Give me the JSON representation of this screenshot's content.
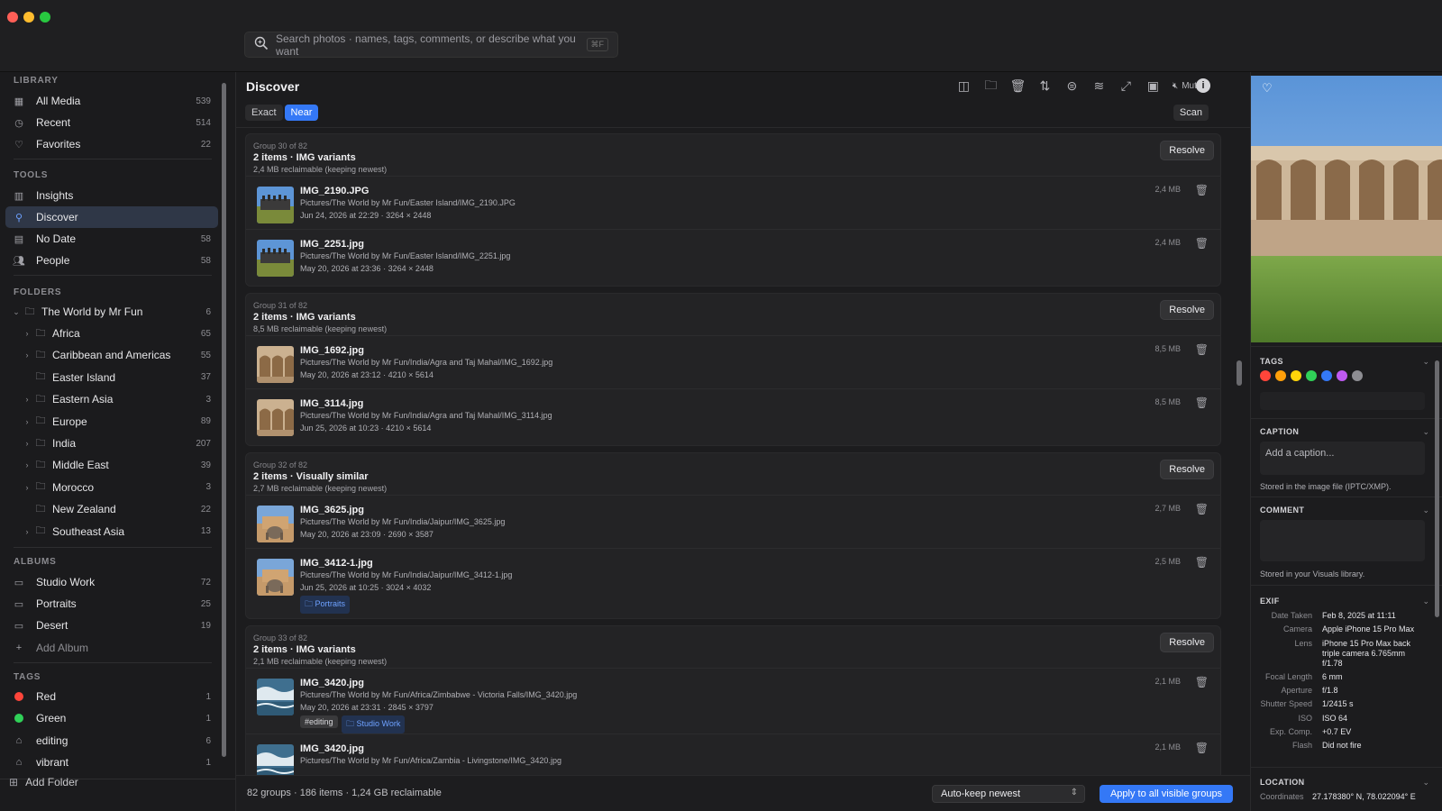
{
  "search": {
    "placeholder": "Search photos · names, tags, comments, or describe what you want",
    "shortcut": "⌘F"
  },
  "sidebar": {
    "library_heading": "LIBRARY",
    "library": [
      {
        "label": "All Media",
        "count": "539"
      },
      {
        "label": "Recent",
        "count": "514"
      },
      {
        "label": "Favorites",
        "count": "22"
      }
    ],
    "tools_heading": "TOOLS",
    "tools": [
      {
        "label": "Insights",
        "count": ""
      },
      {
        "label": "Discover",
        "count": ""
      },
      {
        "label": "No Date",
        "count": "58"
      },
      {
        "label": "People",
        "count": "58"
      }
    ],
    "folders_heading": "FOLDERS",
    "root_folder": {
      "label": "The World by Mr Fun",
      "count": "6"
    },
    "folders": [
      {
        "label": "Africa",
        "count": "65"
      },
      {
        "label": "Caribbean and Americas",
        "count": "55"
      },
      {
        "label": "Easter Island",
        "count": "37"
      },
      {
        "label": "Eastern Asia",
        "count": "3"
      },
      {
        "label": "Europe",
        "count": "89"
      },
      {
        "label": "India",
        "count": "207"
      },
      {
        "label": "Middle East",
        "count": "39"
      },
      {
        "label": "Morocco",
        "count": "3"
      },
      {
        "label": "New Zealand",
        "count": "22"
      },
      {
        "label": "Southeast Asia",
        "count": "13"
      }
    ],
    "albums_heading": "ALBUMS",
    "albums": [
      {
        "label": "Studio Work",
        "count": "72"
      },
      {
        "label": "Portraits",
        "count": "25"
      },
      {
        "label": "Desert",
        "count": "19"
      }
    ],
    "add_album": "Add Album",
    "tags_heading": "TAGS",
    "tags": [
      {
        "label": "Red",
        "count": "1",
        "color": "#ff453a"
      },
      {
        "label": "Green",
        "count": "1",
        "color": "#30d158"
      },
      {
        "label": "editing",
        "count": "6",
        "color": ""
      },
      {
        "label": "vibrant",
        "count": "1",
        "color": ""
      }
    ],
    "add_folder": "Add Folder"
  },
  "main": {
    "title": "Discover",
    "muted_label": "Muted",
    "toolbar_icons": [
      "sidebar-toggle-icon",
      "folder-add-icon",
      "trash-icon",
      "sort-icon",
      "filter-icon",
      "stack-icon",
      "expand-icon",
      "clipboard-icon"
    ],
    "mode_exact": "Exact",
    "mode_near": "Near",
    "scan_label": "Scan",
    "resolve_label": "Resolve",
    "groups": [
      {
        "number": "Group 30 of 82",
        "title": "2 items · IMG variants",
        "reclaim": "2,4 MB reclaimable (keeping newest)",
        "items": [
          {
            "name": "IMG_2190.JPG",
            "path": "Pictures/The World by Mr Fun/Easter Island/IMG_2190.JPG",
            "meta": "Jun 24, 2026 at 22:29 · 3264 × 2448",
            "size": "2,4 MB"
          },
          {
            "name": "IMG_2251.jpg",
            "path": "Pictures/The World by Mr Fun/Easter Island/IMG_2251.jpg",
            "meta": "May 20, 2026 at 23:36 · 3264 × 2448",
            "size": "2,4 MB"
          }
        ]
      },
      {
        "number": "Group 31 of 82",
        "title": "2 items · IMG variants",
        "reclaim": "8,5 MB reclaimable (keeping newest)",
        "items": [
          {
            "name": "IMG_1692.jpg",
            "path": "Pictures/The World by Mr Fun/India/Agra and Taj Mahal/IMG_1692.jpg",
            "meta": "May 20, 2026 at 23:12 · 4210 × 5614",
            "size": "8,5 MB"
          },
          {
            "name": "IMG_3114.jpg",
            "path": "Pictures/The World by Mr Fun/India/Agra and Taj Mahal/IMG_3114.jpg",
            "meta": "Jun 25, 2026 at 10:23 · 4210 × 5614",
            "size": "8,5 MB"
          }
        ]
      },
      {
        "number": "Group 32 of 82",
        "title": "2 items · Visually similar",
        "reclaim": "2,7 MB reclaimable (keeping newest)",
        "items": [
          {
            "name": "IMG_3625.jpg",
            "path": "Pictures/The World by Mr Fun/India/Jaipur/IMG_3625.jpg",
            "meta": "May 20, 2026 at 23:09 · 2690 × 3587",
            "size": "2,7 MB"
          },
          {
            "name": "IMG_3412-1.jpg",
            "path": "Pictures/The World by Mr Fun/India/Jaipur/IMG_3412-1.jpg",
            "meta": "Jun 25, 2026 at 10:25 · 3024 × 4032",
            "size": "2,5 MB",
            "chip": "Portraits"
          }
        ]
      },
      {
        "number": "Group 33 of 82",
        "title": "2 items · IMG variants",
        "reclaim": "2,1 MB reclaimable (keeping newest)",
        "items": [
          {
            "name": "IMG_3420.jpg",
            "path": "Pictures/The World by Mr Fun/Africa/Zimbabwe - Victoria Falls/IMG_3420.jpg",
            "meta": "May 20, 2026 at 23:31 · 2845 × 3797",
            "size": "2,1 MB",
            "tag": "#editing",
            "chip": "Studio Work"
          },
          {
            "name": "IMG_3420.jpg",
            "path": "Pictures/The World by Mr Fun/Africa/Zambia - Livingstone/IMG_3420.jpg",
            "meta": "",
            "size": "2,1 MB"
          }
        ]
      }
    ],
    "footer": {
      "stats": "82 groups · 186 items · 1,24 GB reclaimable",
      "keep_option": "Auto-keep newest",
      "apply_label": "Apply to all visible groups"
    }
  },
  "inspector": {
    "tags_heading": "TAGS",
    "tag_colors": [
      "#ff453a",
      "#ff9f0a",
      "#ffd60a",
      "#30d158",
      "#3478f6",
      "#bf5af2",
      "#8e8e93"
    ],
    "caption_heading": "CAPTION",
    "caption_placeholder": "Add a caption...",
    "caption_note": "Stored in the image file (IPTC/XMP).",
    "comment_heading": "COMMENT",
    "comment_note": "Stored in your Visuals library.",
    "exif_heading": "EXIF",
    "exif": [
      {
        "k": "Date Taken",
        "v": "Feb 8, 2025 at 11:11"
      },
      {
        "k": "Camera",
        "v": "Apple iPhone 15 Pro Max"
      },
      {
        "k": "Lens",
        "v": "iPhone 15 Pro Max back triple camera 6.765mm f/1.78"
      },
      {
        "k": "Focal Length",
        "v": "6 mm"
      },
      {
        "k": "Aperture",
        "v": "f/1.8"
      },
      {
        "k": "Shutter Speed",
        "v": "1/2415 s"
      },
      {
        "k": "ISO",
        "v": "ISO 64"
      },
      {
        "k": "Exp. Comp.",
        "v": "+0.7 EV"
      },
      {
        "k": "Flash",
        "v": "Did not fire"
      }
    ],
    "location_heading": "LOCATION",
    "coordinates_label": "Coordinates",
    "coordinates_value": "27.178380° N, 78.022094° E"
  }
}
